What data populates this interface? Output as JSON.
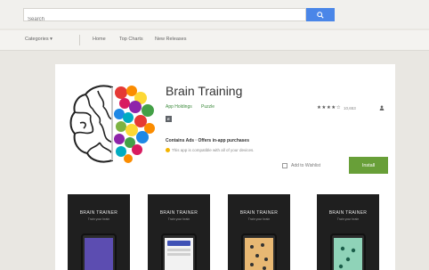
{
  "search": {
    "placeholder": "Search"
  },
  "nav": {
    "categories": "Categories ▾",
    "home": "Home",
    "top_charts": "Top Charts",
    "new_releases": "New Releases"
  },
  "app": {
    "title": "Brain Training",
    "developer": "App Holdings",
    "category": "Puzzle",
    "content_rating": "E",
    "stars": "★★★★☆",
    "rating_count": "10,653",
    "ads_notice": "Contains Ads · Offers in-app purchases",
    "compatibility": "This app is compatible with all of your devices.",
    "wishlist": "Add to Wishlist",
    "install": "Install"
  },
  "screenshots": [
    {
      "title": "BRAIN TRAINER",
      "subtitle": "Train your brain"
    },
    {
      "title": "BRAIN TRAINER",
      "subtitle": "Train your brain"
    },
    {
      "title": "BRAIN TRAINER",
      "subtitle": "Train your brain"
    },
    {
      "title": "BRAIN TRAINER",
      "subtitle": "Train your brain"
    }
  ],
  "colors": {
    "accent_blue": "#4a86e8",
    "install_green": "#689f38",
    "link_green": "#3b8a3b"
  }
}
